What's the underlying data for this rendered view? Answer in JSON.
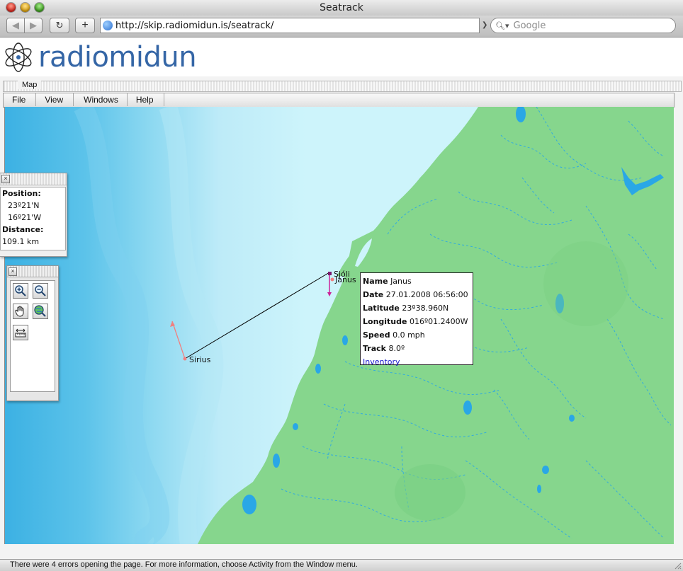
{
  "window": {
    "title": "Seatrack"
  },
  "toolbar": {
    "url": "http://skip.radiomidun.is/seatrack/",
    "search_placeholder": "Google"
  },
  "logo": {
    "text": "radiomidun"
  },
  "map_window": {
    "title": "Map",
    "menu": [
      "File",
      "View",
      "Windows",
      "Help"
    ]
  },
  "position_panel": {
    "position_label": "Position:",
    "lat": "23º21'N",
    "lon": "16º21'W",
    "distance_label": "Distance:",
    "distance": "109.1 km"
  },
  "map": {
    "vessels": [
      {
        "name": "Sirius"
      },
      {
        "name": "Sjóli"
      },
      {
        "name": "Janus"
      }
    ],
    "colors": {
      "deep_sea": "#3fb3e4",
      "shallow_sea": "#cdf4fb",
      "land": "#86d68d",
      "water_inland": "#2aa7e6"
    }
  },
  "popup": {
    "name_label": "Name",
    "name": "Janus",
    "date_label": "Date",
    "date": "27.01.2008 06:56:00",
    "lat_label": "Latitude",
    "lat": "23º38.960N",
    "lon_label": "Longitude",
    "lon": "016º01.2400W",
    "speed_label": "Speed",
    "speed": "0.0 mph",
    "track_label": "Track",
    "track": "8.0º",
    "link": "Inventory"
  },
  "status": {
    "text": "There were 4 errors opening the page. For more information, choose Activity from the Window menu."
  }
}
